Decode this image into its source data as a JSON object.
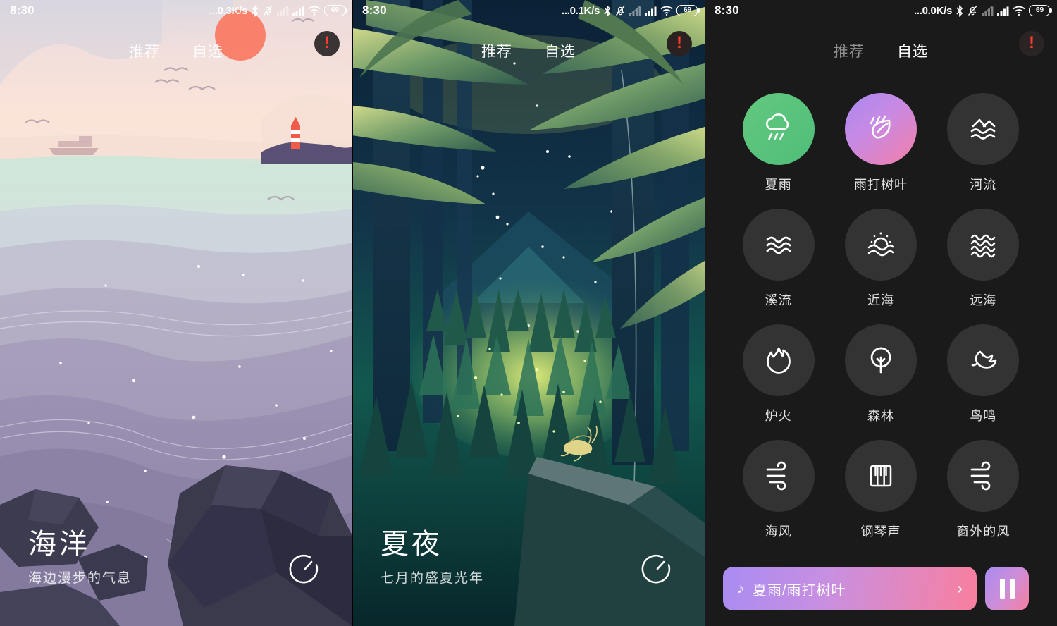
{
  "statusbar": {
    "time": "8:30",
    "net_speed_p1": "...0.3K/s",
    "net_speed_p2": "...0.1K/s",
    "net_speed_p3": "...0.0K/s",
    "battery": "69",
    "icons": [
      "bluetooth-icon",
      "bell-muted-icon",
      "signal-weak-icon",
      "signal-icon",
      "wifi-icon",
      "battery-icon"
    ]
  },
  "tabs": {
    "recommend": "推荐",
    "custom": "自选"
  },
  "alert": {
    "glyph": "!",
    "color": "#ff3b30"
  },
  "panels": [
    {
      "id": "ocean",
      "active_tab": "推荐",
      "title": "海洋",
      "subtitle": "海边漫步的气息",
      "timer_icon": "timer-icon"
    },
    {
      "id": "summer-night",
      "active_tab": "推荐",
      "title": "夏夜",
      "subtitle": "七月的盛夏光年",
      "timer_icon": "timer-icon"
    },
    {
      "id": "sound-grid",
      "active_tab": "自选"
    }
  ],
  "grid": {
    "items": [
      {
        "label": "夏雨",
        "icon": "rain-cloud-icon",
        "state": "active-green"
      },
      {
        "label": "雨打树叶",
        "icon": "leaf-rain-icon",
        "state": "active-pink"
      },
      {
        "label": "河流",
        "icon": "river-icon",
        "state": "idle"
      },
      {
        "label": "溪流",
        "icon": "stream-icon",
        "state": "idle"
      },
      {
        "label": "近海",
        "icon": "near-sea-icon",
        "state": "idle"
      },
      {
        "label": "远海",
        "icon": "far-sea-icon",
        "state": "idle"
      },
      {
        "label": "炉火",
        "icon": "fire-icon",
        "state": "idle"
      },
      {
        "label": "森林",
        "icon": "tree-icon",
        "state": "idle"
      },
      {
        "label": "鸟鸣",
        "icon": "bird-icon",
        "state": "idle"
      },
      {
        "label": "海风",
        "icon": "wind-icon",
        "state": "idle"
      },
      {
        "label": "钢琴声",
        "icon": "piano-icon",
        "state": "idle"
      },
      {
        "label": "窗外的风",
        "icon": "wind-icon",
        "state": "idle"
      }
    ]
  },
  "player": {
    "note_glyph": "♪",
    "track": "夏雨/雨打树叶",
    "arrow_glyph": "›",
    "play_state": "playing",
    "play_icon": "pause-icon"
  },
  "colors": {
    "accent_green": "#5ec47b",
    "accent_pink_start": "#a98cf2",
    "accent_pink_end": "#f97f9e",
    "grid_bg": "#1a1a1a",
    "bubble_idle": "#333333",
    "alert_red": "#ff3b30"
  }
}
